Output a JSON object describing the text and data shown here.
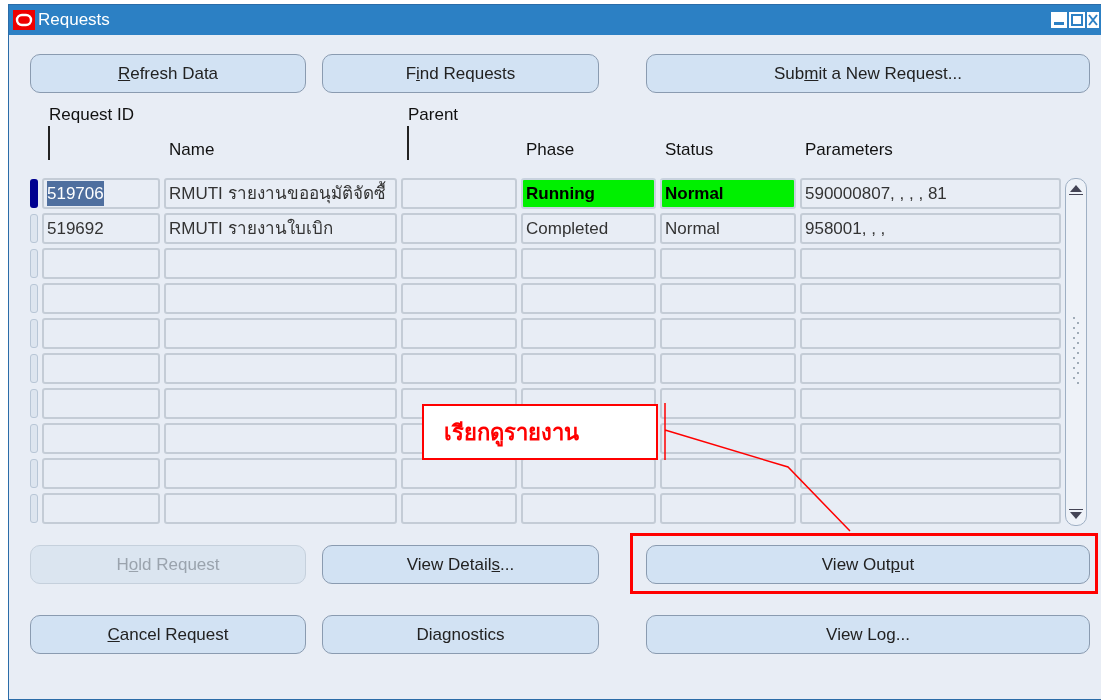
{
  "window": {
    "title": "Requests"
  },
  "top_buttons": [
    {
      "key": "R",
      "after": "efresh Data",
      "disabled": false
    },
    {
      "before": "F",
      "key": "i",
      "after": "nd Requests",
      "disabled": false
    },
    {
      "before": "Sub",
      "key": "m",
      "after": "it a New Request...",
      "disabled": false
    }
  ],
  "table": {
    "columns": [
      {
        "label": "Request ID",
        "kind": "raised"
      },
      {
        "label": "Name",
        "kind": "plain"
      },
      {
        "label": "Parent",
        "kind": "raised"
      },
      {
        "label": "Phase",
        "kind": "plain"
      },
      {
        "label": "Status",
        "kind": "plain"
      },
      {
        "label": "Parameters",
        "kind": "plain"
      }
    ],
    "rows": [
      {
        "selected": true,
        "highlight": true,
        "cells": [
          "519706",
          "RMUTI รายงานขออนุมัติจัดซื้",
          "",
          "Running",
          "Normal",
          "590000807, , , , 81"
        ]
      },
      {
        "selected": false,
        "highlight": false,
        "cells": [
          "519692",
          "RMUTI รายงานใบเบิก",
          "",
          "Completed",
          "Normal",
          "958001, , ,"
        ]
      }
    ]
  },
  "bottom_buttons": [
    [
      {
        "before": "H",
        "key": "o",
        "after": "ld Request",
        "disabled": true
      },
      {
        "before": "View Detail",
        "key": "s",
        "after": "...",
        "disabled": false
      },
      {
        "before": "View Out",
        "key": "p",
        "after": "ut",
        "disabled": false
      }
    ],
    [
      {
        "key": "C",
        "after": "ancel Request",
        "disabled": false
      },
      {
        "before": "Diagnostics",
        "disabled": false
      },
      {
        "before": "View Log...",
        "disabled": false
      }
    ]
  ],
  "callout": {
    "text": "เรียกดูรายงาน"
  }
}
